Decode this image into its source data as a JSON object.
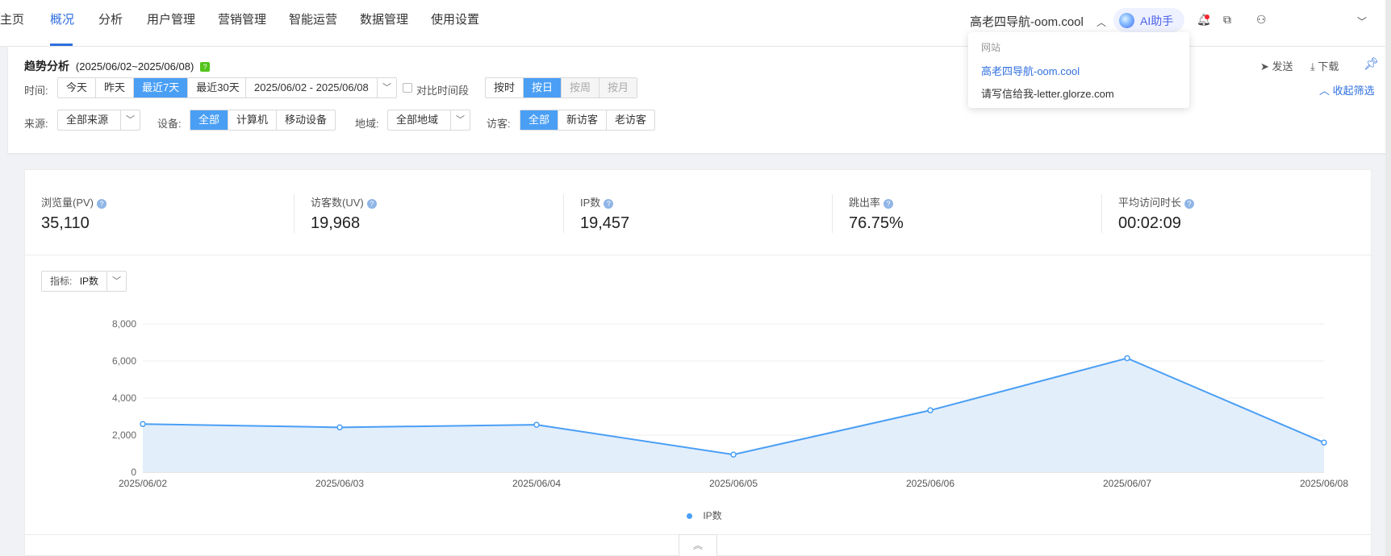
{
  "nav": {
    "items": [
      "主页",
      "概况",
      "分析",
      "用户管理",
      "营销管理",
      "智能运营",
      "数据管理",
      "使用设置"
    ],
    "active": "概况"
  },
  "header": {
    "site_name": "高老四导航-oom.cool",
    "ai_label": "AI助手"
  },
  "site_dropdown": {
    "heading": "网站",
    "options": [
      "高老四导航-oom.cool",
      "请写信给我-letter.glorze.com"
    ],
    "selected": "高老四导航-oom.cool"
  },
  "filters": {
    "title": "趋势分析",
    "date_range_text": "(2025/06/02~2025/06/08)",
    "help": "?",
    "send_label": "发送",
    "download_label": "下载",
    "collapse_label": "收起筛选",
    "time_label": "时间:",
    "time_options": [
      "今天",
      "昨天",
      "最近7天",
      "最近30天"
    ],
    "time_selected": "最近7天",
    "date_picker_value": "2025/06/02 - 2025/06/08",
    "compare_label": "对比时间段",
    "granularity_options": [
      "按时",
      "按日",
      "按周",
      "按月"
    ],
    "granularity_selected": "按日",
    "source_label": "来源:",
    "source_value": "全部来源",
    "device_label": "设备:",
    "device_options": [
      "全部",
      "计算机",
      "移动设备"
    ],
    "device_selected": "全部",
    "region_label": "地域:",
    "region_value": "全部地域",
    "visitor_label": "访客:",
    "visitor_options": [
      "全部",
      "新访客",
      "老访客"
    ],
    "visitor_selected": "全部"
  },
  "metrics": [
    {
      "title": "浏览量(PV)",
      "value": "35,110"
    },
    {
      "title": "访客数(UV)",
      "value": "19,968"
    },
    {
      "title": "IP数",
      "value": "19,457"
    },
    {
      "title": "跳出率",
      "value": "76.75%"
    },
    {
      "title": "平均访问时长",
      "value": "00:02:09"
    }
  ],
  "indicator": {
    "label": "指标:",
    "value": "IP数"
  },
  "chart_data": {
    "type": "area",
    "x": [
      "2025/06/02",
      "2025/06/03",
      "2025/06/04",
      "2025/06/05",
      "2025/06/06",
      "2025/06/07",
      "2025/06/08"
    ],
    "series": [
      {
        "name": "IP数",
        "values": [
          2600,
          2420,
          2560,
          950,
          3340,
          6150,
          1600
        ]
      }
    ],
    "ylim": [
      0,
      8000
    ],
    "yticks": [
      "0",
      "2,000",
      "4,000",
      "6,000",
      "8,000"
    ],
    "grid": true,
    "legend": "bottom-center",
    "color": "#4a9ff5"
  },
  "colors": {
    "accent": "#2f6fde",
    "active_fill": "#4a9ff5",
    "line": "#4a9ff5"
  }
}
